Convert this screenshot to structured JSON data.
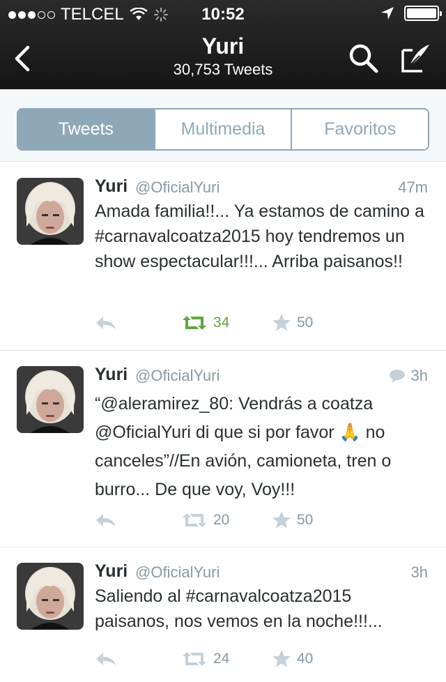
{
  "status": {
    "carrier": "TELCEL",
    "time": "10:52"
  },
  "nav": {
    "title": "Yuri",
    "subtitle": "30,753 Tweets"
  },
  "tabs": [
    {
      "label": "Tweets",
      "active": true
    },
    {
      "label": "Multimedia",
      "active": false
    },
    {
      "label": "Favoritos",
      "active": false
    }
  ],
  "tweets": [
    {
      "name": "Yuri",
      "handle": "@OficialYuri",
      "time": "47m",
      "text": "Amada familia!!... Ya estamos de camino a #carnavalcoatza2015 hoy tendremos un show espectacular!!!... Arriba paisanos!!",
      "retweets": "34",
      "favorites": "50",
      "retweeted": true,
      "is_reply": false
    },
    {
      "name": "Yuri",
      "handle": "@OficialYuri",
      "time": "3h",
      "text": "“@aleramirez_80: Vendrás a coatza @OficialYuri di que si por favor 🙏 no canceles”//En avión, camioneta, tren o burro... De que voy, Voy!!!",
      "retweets": "20",
      "favorites": "50",
      "retweeted": false,
      "is_reply": true
    },
    {
      "name": "Yuri",
      "handle": "@OficialYuri",
      "time": "3h",
      "text": "Saliendo al #carnavalcoatza2015 paisanos, nos vemos en la noche!!!...",
      "retweets": "24",
      "favorites": "40",
      "retweeted": false,
      "is_reply": false
    }
  ],
  "colors": {
    "header_bg": "#1c1c1c",
    "tab_accent": "#8fa8b8",
    "retweet_active": "#5ea642",
    "muted": "#8899a6"
  },
  "icons": [
    "back-icon",
    "search-icon",
    "compose-icon",
    "reply-icon",
    "retweet-icon",
    "favorite-icon",
    "conversation-icon"
  ]
}
